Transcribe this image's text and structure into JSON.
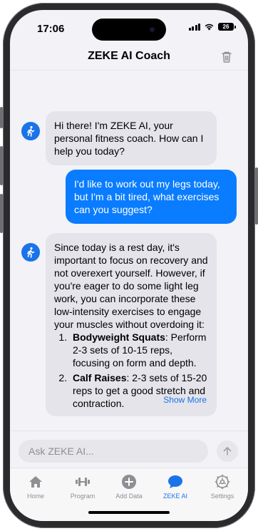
{
  "status_bar": {
    "time": "17:06",
    "battery": "26"
  },
  "header": {
    "title": "ZEKE AI Coach"
  },
  "chat": {
    "messages": [
      {
        "sender": "bot",
        "text": "Hi there! I'm ZEKE AI, your personal fitness coach. How can I help you today?"
      },
      {
        "sender": "user",
        "text": "I'd like to work out my legs today, but I'm a bit tired, what exercises can you suggest?"
      },
      {
        "sender": "bot",
        "text": "Since today is a rest day, it's important to focus on recovery and not overexert yourself. However, if you're eager to do some light leg work, you can incorporate these low-intensity exercises to engage your muscles without overdoing it:",
        "list": [
          {
            "title": "Bodyweight Squats",
            "detail": ": Perform 2-3 sets of 10-15 reps, focusing on form and depth."
          },
          {
            "title": "Calf Raises",
            "detail": ": 2-3 sets of 15-20 reps to get a good stretch and contraction."
          }
        ],
        "show_more": "Show More"
      }
    ]
  },
  "input": {
    "placeholder": "Ask ZEKE AI..."
  },
  "tabbar": {
    "items": [
      {
        "label": "Home",
        "icon": "house-icon"
      },
      {
        "label": "Program",
        "icon": "dumbbell-icon"
      },
      {
        "label": "Add Data",
        "icon": "plus-circle-icon"
      },
      {
        "label": "ZEKE AI",
        "icon": "chat-bubble-icon",
        "active": true
      },
      {
        "label": "Settings",
        "icon": "gear-icon"
      }
    ]
  },
  "colors": {
    "accent": "#1a73e8",
    "user_bubble": "#0a7cff",
    "bot_bubble": "#e4e4ea",
    "background": "#f2f2f7"
  }
}
